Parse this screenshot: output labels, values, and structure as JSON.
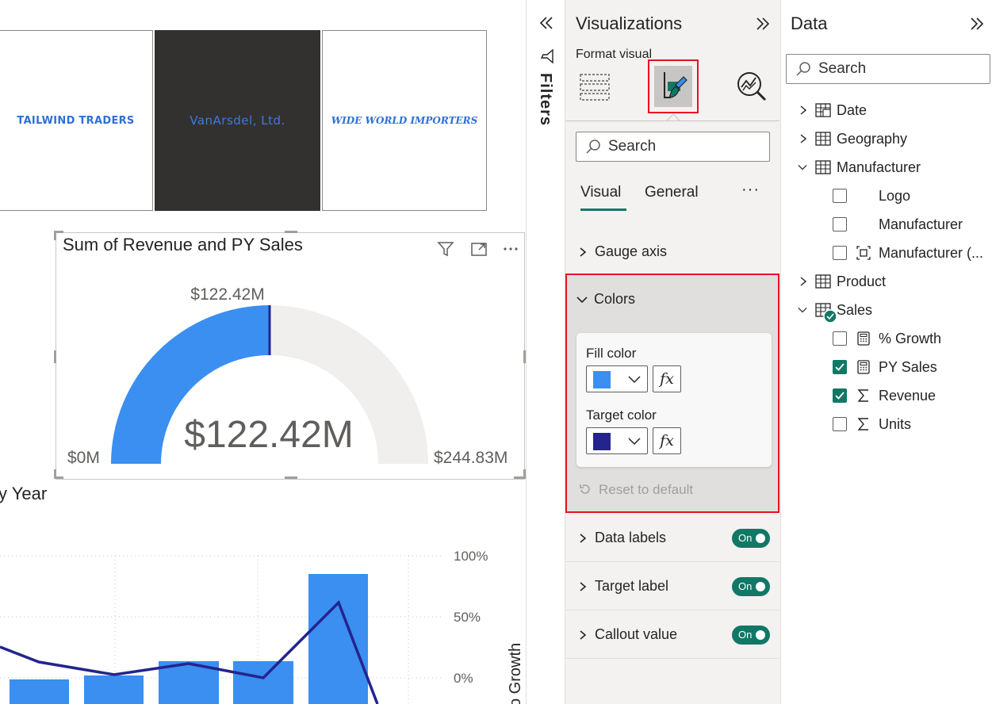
{
  "canvas": {
    "logos": [
      "TAILWIND TRADERS",
      "VanArsdel, Ltd.",
      "WIDE WORLD IMPORTERS"
    ],
    "gauge": {
      "title": "Sum of Revenue and PY Sales",
      "target_label": "$122.42M",
      "callout_value": "$122.42M",
      "min_label": "$0M",
      "max_label": "$244.83M",
      "fill_fraction": 0.5,
      "fill_color": "#3a8ff0",
      "target_color": "#24248f",
      "track_color": "#f0efee"
    },
    "combo_chart": {
      "title": "y Year",
      "right_axis_label": "o Growth",
      "right_axis_ticks": [
        "100%",
        "50%",
        "0%"
      ]
    }
  },
  "filters": {
    "label": "Filters"
  },
  "visualizations": {
    "title": "Visualizations",
    "format_visual_label": "Format visual",
    "search_placeholder": "Search",
    "tabs": [
      "Visual",
      "General"
    ],
    "more_label": "···",
    "sections": {
      "gauge_axis": "Gauge axis",
      "colors": "Colors",
      "data_labels": "Data labels",
      "target_label": "Target label",
      "callout_value": "Callout value"
    },
    "colors": {
      "fill_color_label": "Fill color",
      "fill_color": "#3a8ff0",
      "target_color_label": "Target color",
      "target_color": "#24248f",
      "fx_label": "fx",
      "reset_label": "Reset to default"
    },
    "toggle_on_label": "On"
  },
  "data": {
    "title": "Data",
    "search_placeholder": "Search",
    "tables": {
      "date": "Date",
      "geography": "Geography",
      "manufacturer": "Manufacturer",
      "product": "Product",
      "sales": "Sales"
    },
    "manufacturer_fields": [
      "Logo",
      "Manufacturer",
      "Manufacturer (..."
    ],
    "sales_fields": [
      {
        "label": "% Growth",
        "checked": false
      },
      {
        "label": "PY Sales",
        "checked": true
      },
      {
        "label": "Revenue",
        "checked": true
      },
      {
        "label": "Units",
        "checked": false
      }
    ]
  },
  "accent_color": "#117865",
  "highlight_color": "#e81123"
}
